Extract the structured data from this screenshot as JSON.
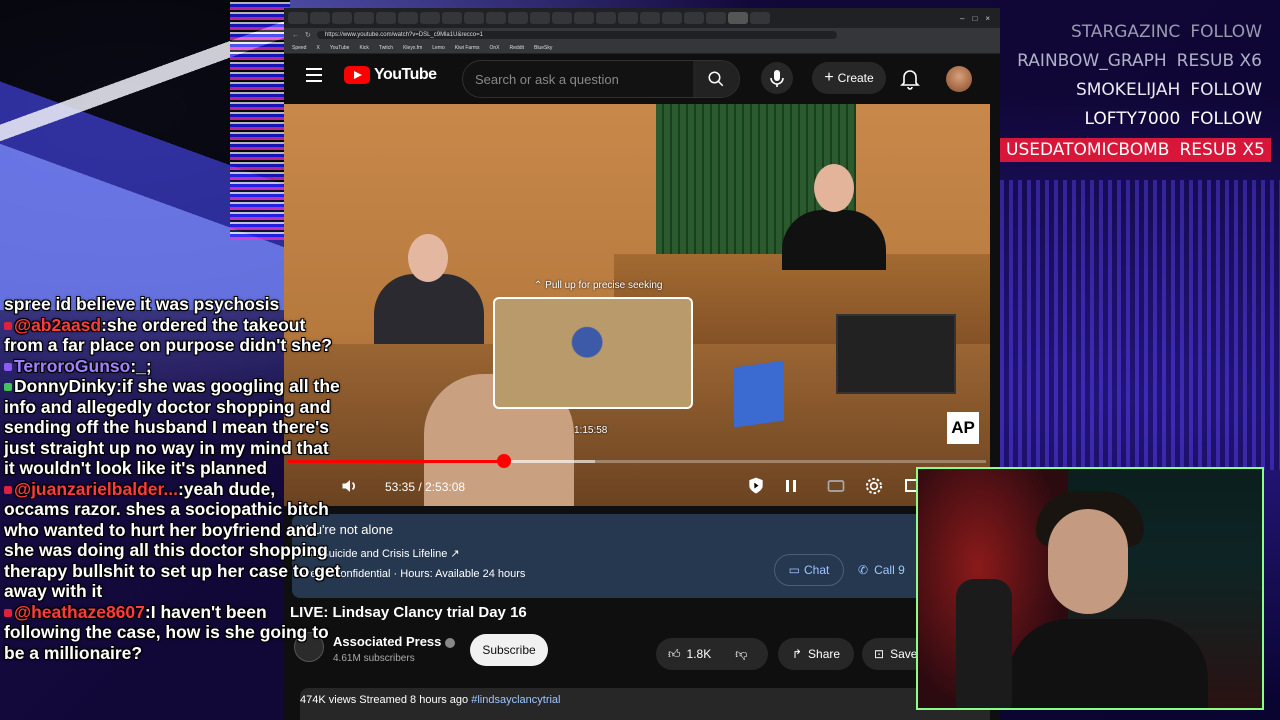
{
  "browser": {
    "url": "https://www.youtube.com/watch?v=DSL_c9Mla1U&recco=1",
    "bookmarks": [
      "Speed",
      "X",
      "YouTube",
      "Kick",
      "Twitch",
      "Kleyx.fm",
      "Lemo",
      "Kiwi Farms",
      "OnX",
      "Reddit",
      "BlueSky"
    ]
  },
  "youtube": {
    "logo_text": "YouTube",
    "search_placeholder": "Search or ask a question",
    "create_label": "Create",
    "player": {
      "seek_hint": "Pull up for precise seeking",
      "preview_time": "1:15:58",
      "current_time": "53:35 / 2:53:08",
      "progress_fraction": 0.31,
      "buffer_fraction": 0.44,
      "channel_watermark": "AP"
    },
    "crisis_panel": {
      "title": "You're not alone",
      "lifeline": "988 Suicide and Crisis Lifeline ↗",
      "info": "Free · Confidential · Hours: Available 24 hours",
      "chat_label": "Chat",
      "call_label": "Call 9"
    },
    "video_title": "LIVE: Lindsay Clancy trial Day 16",
    "channel": {
      "name": "Associated Press",
      "subscribers": "4.61M subscribers",
      "subscribe_label": "Subscribe"
    },
    "actions": {
      "likes": "1.8K",
      "share_label": "Share",
      "save_label": "Save"
    },
    "meta": {
      "views_time": "474K views  Streamed 8 hours ago",
      "hashtag": "#lindsayclancytrial"
    }
  },
  "chat": [
    {
      "user": "",
      "user_color": "#ffffff",
      "badge_color": "",
      "text": "spree id believe it was psychosis"
    },
    {
      "user": "@ab2aasd",
      "user_color": "#ff3b3b",
      "badge_color": "#e0203c",
      "text": ":she ordered the takeout from a far place on purpose didn't she?"
    },
    {
      "user": "TerroroGunso",
      "user_color": "#a080ff",
      "badge_color": "#8a5cf5",
      "text": ":_;"
    },
    {
      "user": "DonnyDinky",
      "user_color": "#ffffff",
      "badge_color": "#3fc45a",
      "text": ":if she was googling all the info and allegedly doctor shopping and sending off the husband I mean there's just straight up no way in my mind that it wouldn't look like it's planned"
    },
    {
      "user": "@juanzarielbalder...",
      "user_color": "#ff3b3b",
      "badge_color": "#e0203c",
      "text": ":yeah dude, occams razor. shes a sociopathic bitch who wanted to hurt her boyfriend and she was doing all this doctor shopping therapy bullshit to set up her case to get away with it"
    },
    {
      "user": "@heathaze8607",
      "user_color": "#ff3b3b",
      "badge_color": "#e0203c",
      "text": ":I haven't been following the case, how is she going to be a millionaire?"
    }
  ],
  "events": [
    {
      "name": "STARGAZINC",
      "action": "FOLLOW",
      "color": "#9a9ab0",
      "highlight": false
    },
    {
      "name": "RAINBOW_GRAPH",
      "action": "RESUB X6",
      "color": "#b0b0c8",
      "highlight": false
    },
    {
      "name": "SMOKELIJAH",
      "action": "FOLLOW",
      "color": "#e8e8f0",
      "highlight": false
    },
    {
      "name": "LOFTY7000",
      "action": "FOLLOW",
      "color": "#ffffff",
      "highlight": false
    },
    {
      "name": "USEDATOMICBOMB",
      "action": "RESUB X5",
      "color": "#ffffff",
      "highlight": true
    }
  ]
}
